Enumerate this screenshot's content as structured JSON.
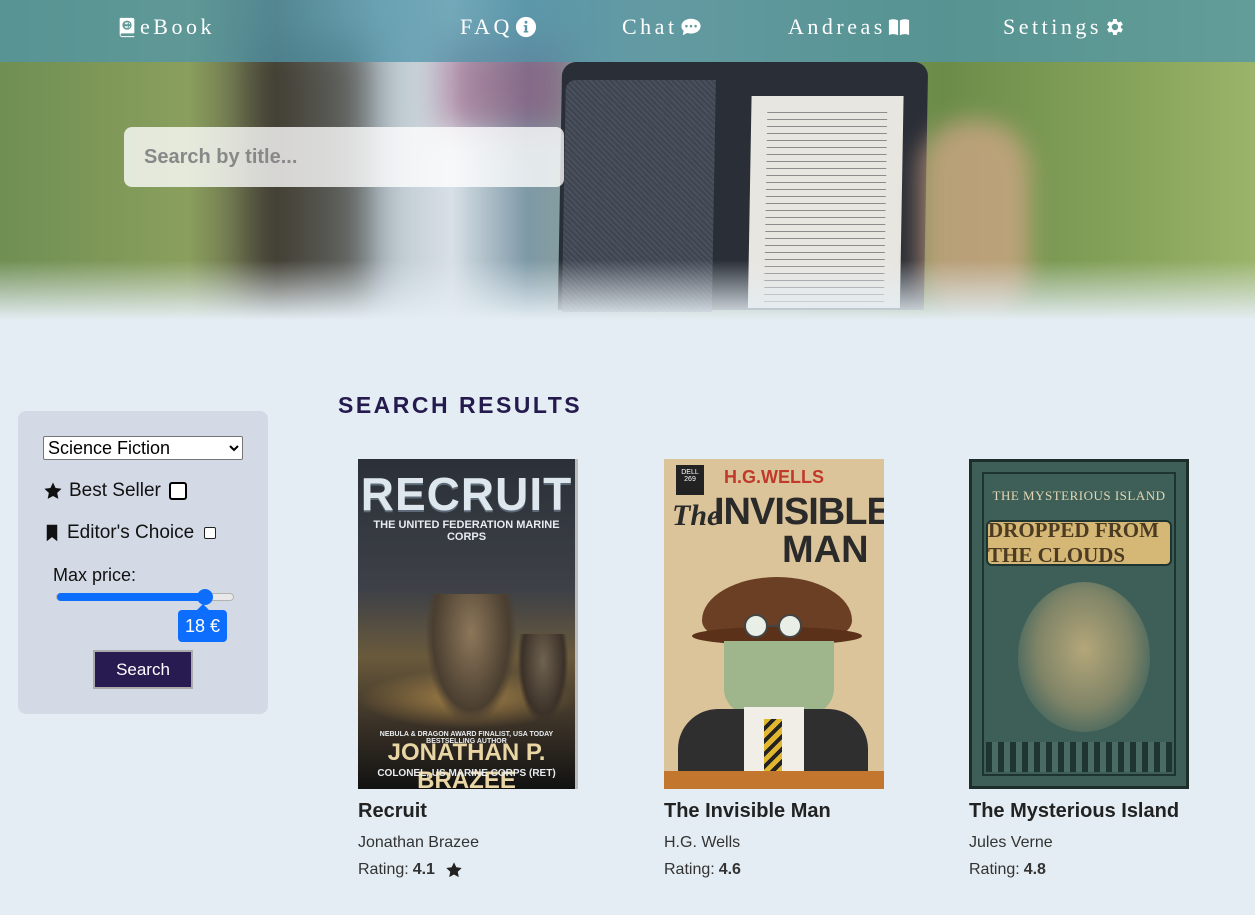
{
  "nav": {
    "brand": "eBook",
    "faq": "FAQ",
    "chat": "Chat",
    "user": "Andreas",
    "settings": "Settings"
  },
  "search": {
    "placeholder": "Search by title..."
  },
  "filters": {
    "genre": "Science Fiction",
    "best_seller_label": "Best Seller",
    "editors_choice_label": "Editor's Choice",
    "max_price_label": "Max price:",
    "max_price_value": 18,
    "max_price_display": "18 €",
    "slider_fraction": 0.84,
    "search_button": "Search"
  },
  "results": {
    "title": "SEARCH RESULTS",
    "rating_label": "Rating:",
    "books": [
      {
        "title": "Recruit",
        "author": "Jonathan Brazee",
        "rating": "4.1",
        "starred": true,
        "cover": {
          "title": "RECRUIT",
          "subtitle": "THE UNITED FEDERATION MARINE CORPS",
          "tagline": "NEBULA & DRAGON AWARD FINALIST, USA TODAY BESTSELLING AUTHOR",
          "author": "JONATHAN P. BRAZEE",
          "rank": "COLONEL, US MARINE CORPS (RET)"
        }
      },
      {
        "title": "The Invisible Man",
        "author": "H.G. Wells",
        "rating": "4.6",
        "starred": false,
        "cover": {
          "author": "H.G.WELLS",
          "publisher": "DELL 269",
          "the": "The",
          "title_line1": "INVISIBLE",
          "title_line2": "MAN"
        }
      },
      {
        "title": "The Mysterious Island",
        "author": "Jules Verne",
        "rating": "4.8",
        "starred": false,
        "cover": {
          "series": "THE MYSTERIOUS ISLAND",
          "title": "DROPPED FROM THE CLOUDS"
        }
      }
    ]
  },
  "colors": {
    "accent": "#0d6efd",
    "heading": "#241a4e",
    "button": "#281b52",
    "background": "#e4edf3",
    "panel": "#d4dae5"
  }
}
